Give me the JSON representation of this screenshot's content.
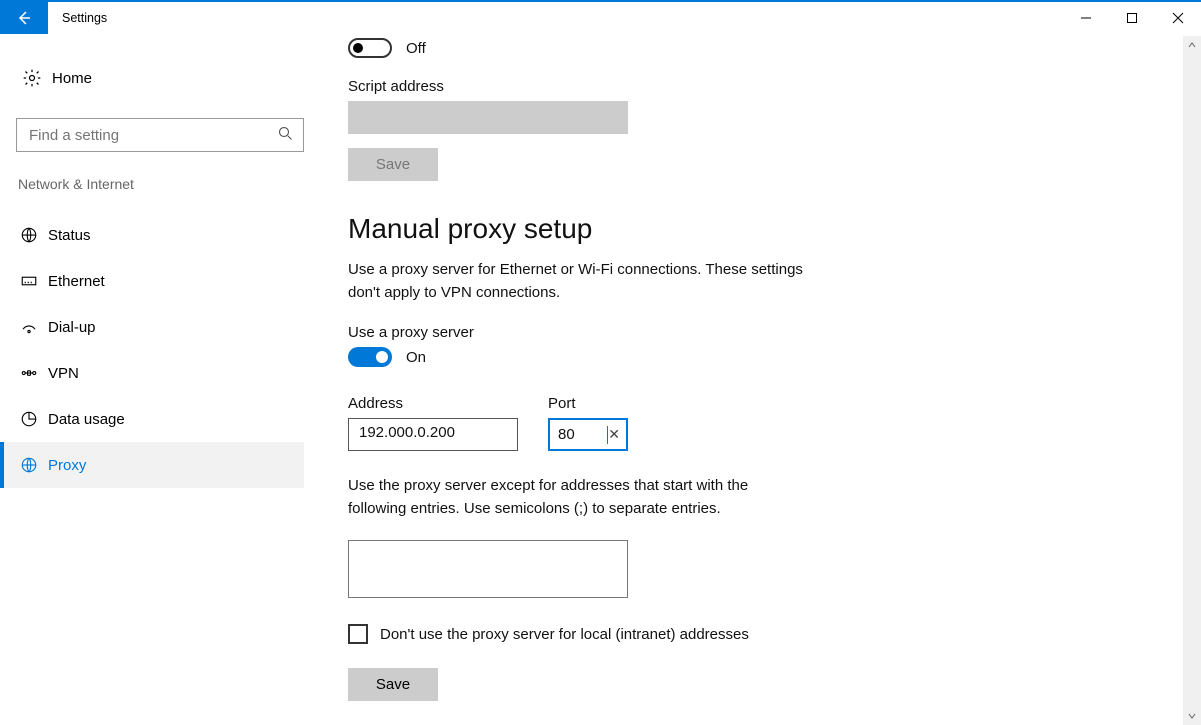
{
  "window": {
    "title": "Settings"
  },
  "sidebar": {
    "home_label": "Home",
    "search_placeholder": "Find a setting",
    "section_label": "Network & Internet",
    "items": [
      {
        "label": "Status",
        "icon": "status-icon",
        "active": false
      },
      {
        "label": "Ethernet",
        "icon": "ethernet-icon",
        "active": false
      },
      {
        "label": "Dial-up",
        "icon": "dialup-icon",
        "active": false
      },
      {
        "label": "VPN",
        "icon": "vpn-icon",
        "active": false
      },
      {
        "label": "Data usage",
        "icon": "data-icon",
        "active": false
      },
      {
        "label": "Proxy",
        "icon": "globe-icon",
        "active": true
      }
    ]
  },
  "proxy": {
    "auto_toggle_label": "Off",
    "script_label": "Script address",
    "script_value": "",
    "auto_save_label": "Save",
    "manual_heading": "Manual proxy setup",
    "manual_desc": "Use a proxy server for Ethernet or Wi-Fi connections. These settings don't apply to VPN connections.",
    "use_label": "Use a proxy server",
    "use_toggle_label": "On",
    "address_label": "Address",
    "address_value": "192.000.0.200",
    "port_label": "Port",
    "port_value": "80",
    "exceptions_desc": "Use the proxy server except for addresses that start with the following entries. Use semicolons (;) to separate entries.",
    "exceptions_value": "",
    "local_checkbox_label": "Don't use the proxy server for local (intranet) addresses",
    "manual_save_label": "Save"
  }
}
